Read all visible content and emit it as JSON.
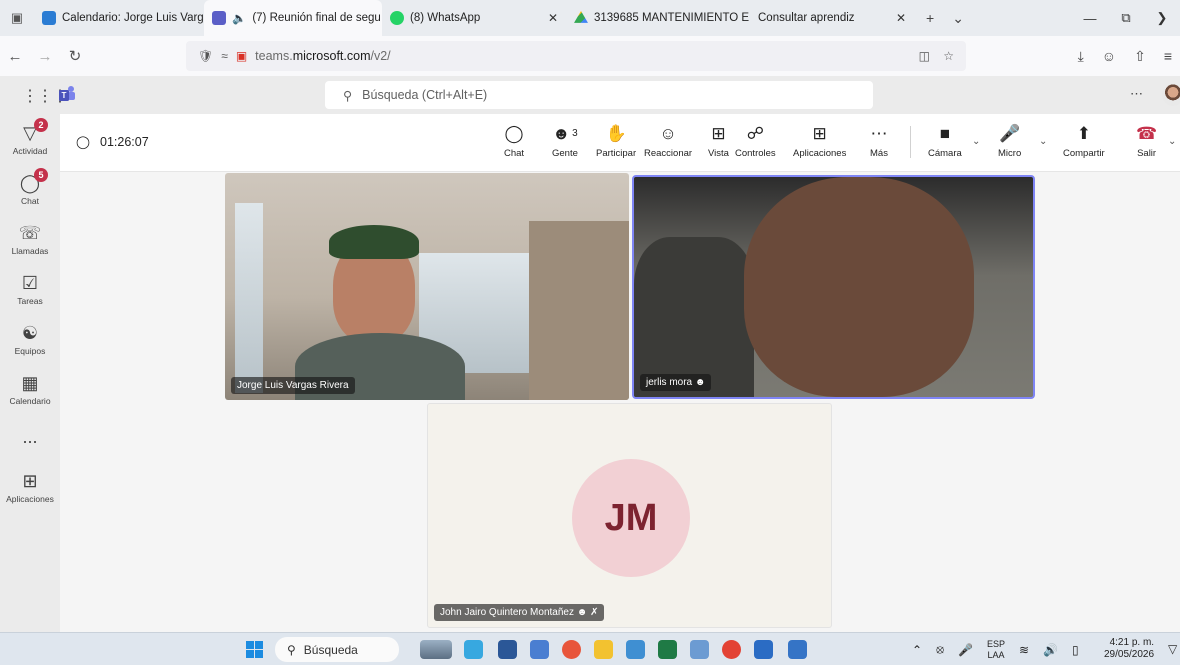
{
  "browser": {
    "tabs": [
      {
        "label": "Calendario: Jorge Luis Vargas",
        "icon": "calendar-icon"
      },
      {
        "label": "(7) Reunión final de segu",
        "icon": "teams-icon",
        "active": true
      },
      {
        "label": "(8) WhatsApp",
        "icon": "whatsapp-icon"
      },
      {
        "label": "3139685 MANTENIMIENTO E",
        "icon": "drive-icon"
      },
      {
        "label": "Consultar aprendiz",
        "icon": ""
      }
    ],
    "url_prefix": "teams.",
    "url_domain": "microsoft.com",
    "url_path": "/v2/"
  },
  "teams": {
    "search_placeholder": "Búsqueda (Ctrl+Alt+E)",
    "rail": [
      {
        "label": "Actividad",
        "icon": "bell-icon",
        "badge": "2"
      },
      {
        "label": "Chat",
        "icon": "chat-icon",
        "badge": "5"
      },
      {
        "label": "Llamadas",
        "icon": "phone-icon",
        "badge": ""
      },
      {
        "label": "Tareas",
        "icon": "tasks-icon",
        "badge": ""
      },
      {
        "label": "Equipos",
        "icon": "teams-group-icon",
        "badge": ""
      },
      {
        "label": "Calendario",
        "icon": "calendar-icon",
        "badge": ""
      },
      {
        "label": "...",
        "icon": "more-icon",
        "badge": ""
      },
      {
        "label": "Aplicaciones",
        "icon": "add-apps-icon",
        "badge": ""
      }
    ]
  },
  "meeting": {
    "timer": "01:26:07",
    "people_count": "3",
    "toolbar": {
      "chat": "Chat",
      "people": "Gente",
      "raise": "Participar",
      "react": "Reaccionar",
      "view": "Vista",
      "controls": "Controles",
      "apps": "Aplicaciones",
      "more": "Más",
      "camera": "Cámara",
      "mic": "Micro",
      "share": "Compartir",
      "leave": "Salir"
    },
    "participants": [
      {
        "name": "Jorge Luis Vargas Rivera"
      },
      {
        "name": "jerlis mora"
      },
      {
        "name": "John Jairo Quintero Montañez",
        "initials": "JM"
      }
    ]
  },
  "taskbar": {
    "search_label": "Búsqueda",
    "language": "ESP",
    "language_region": "LAA",
    "time": "4:21 p. m.",
    "date": "29/05/2026"
  }
}
